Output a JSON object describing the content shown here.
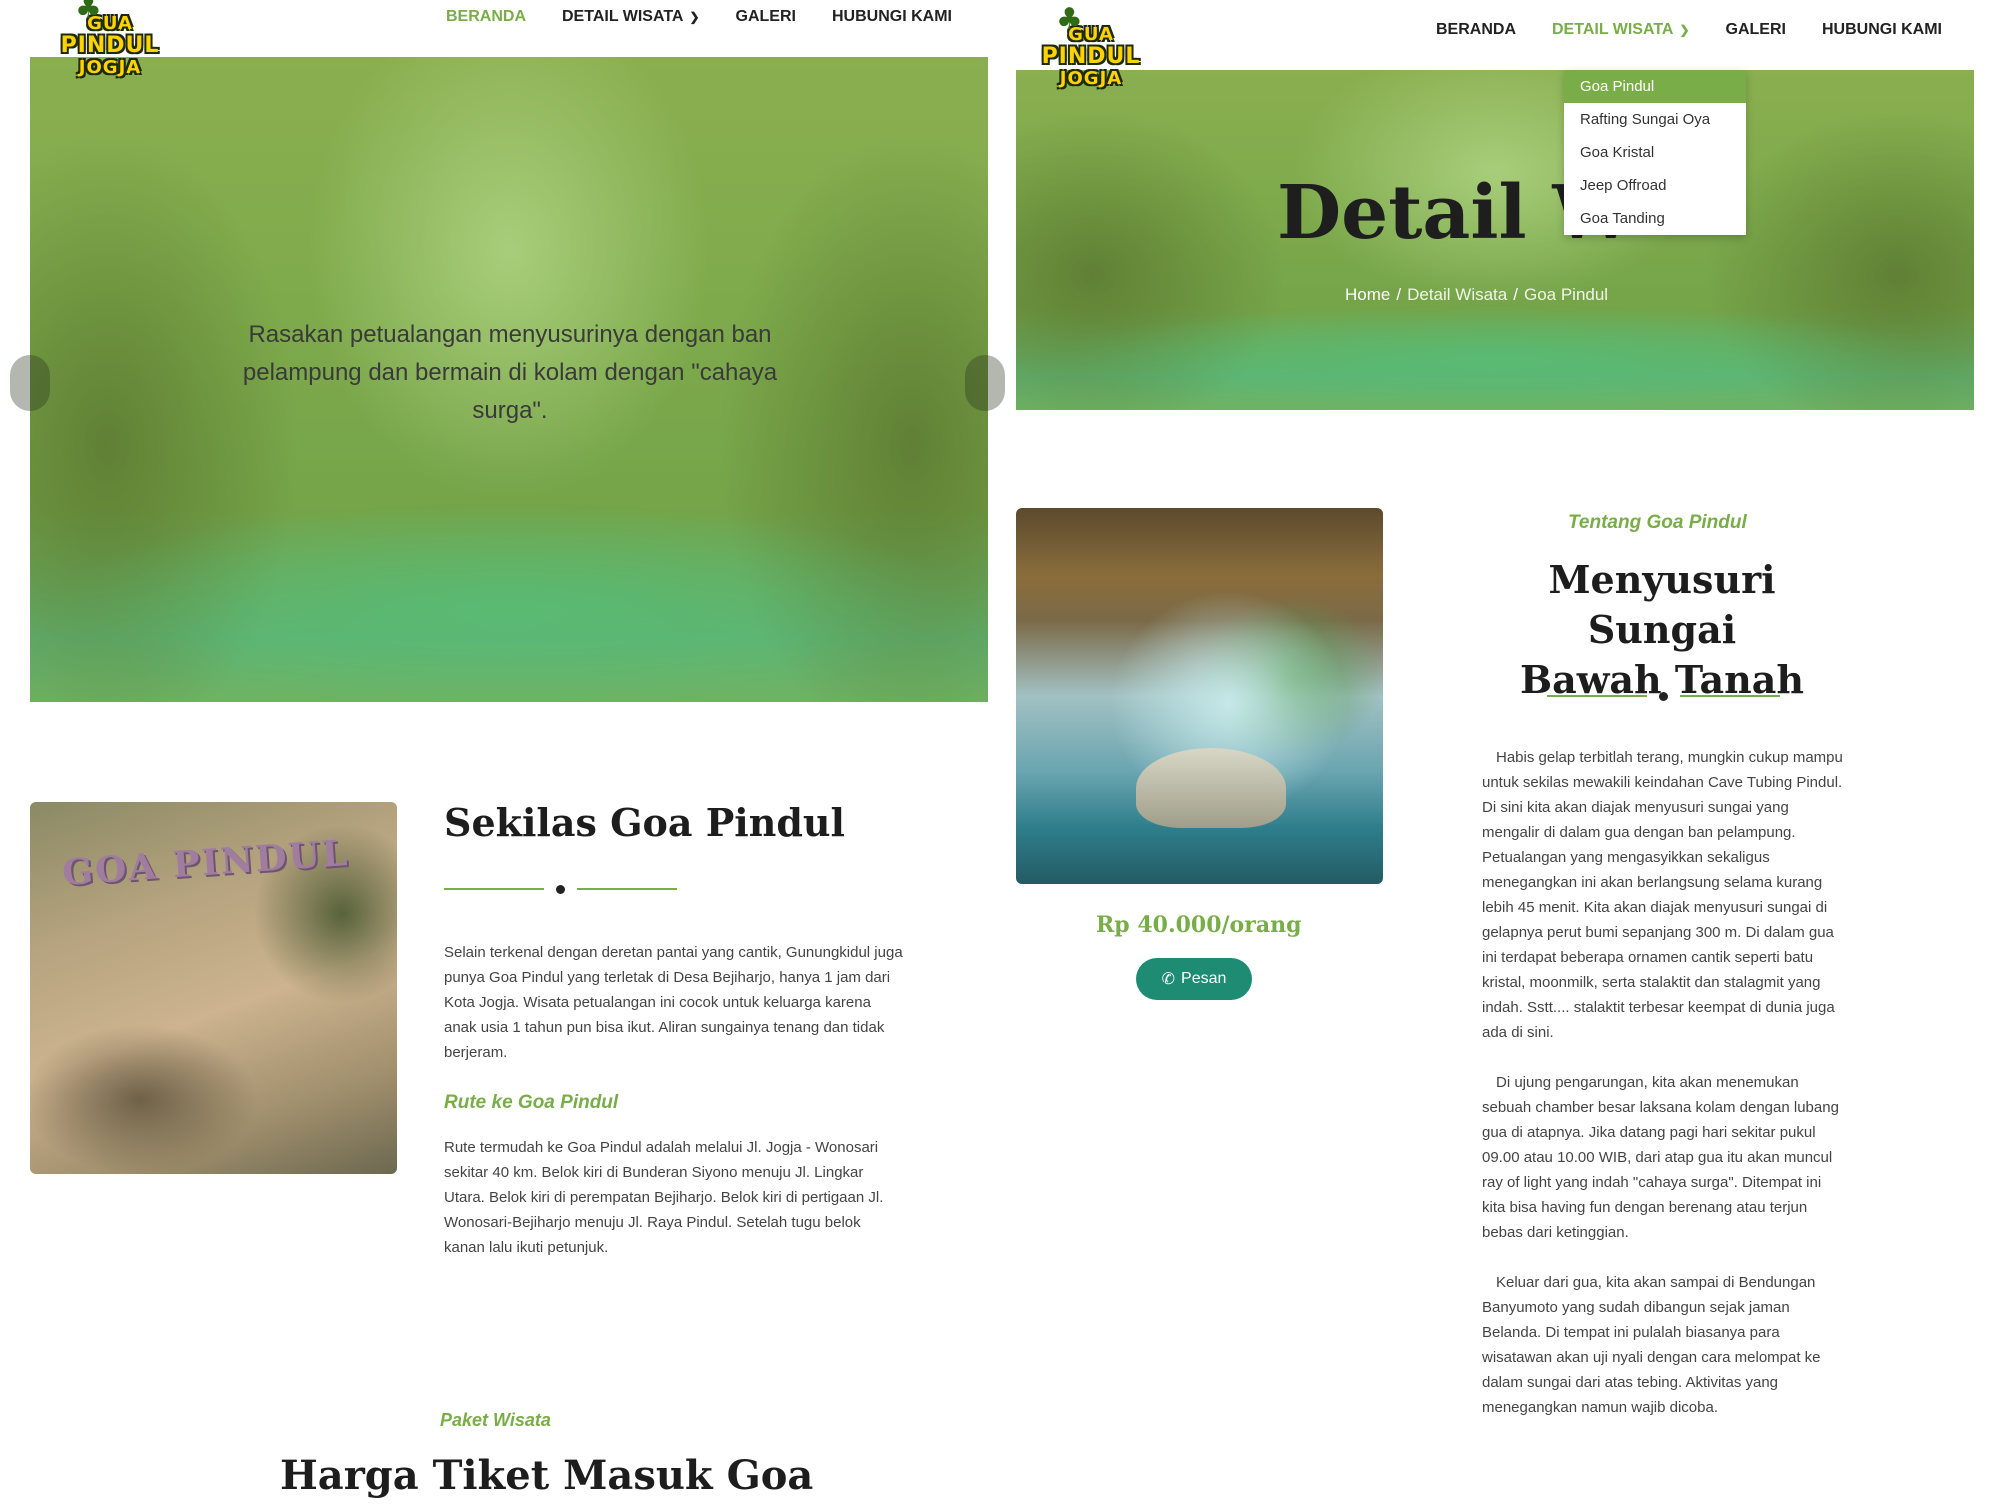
{
  "brand": {
    "logo_line1": "GUA",
    "logo_line2": "PINDUL",
    "logo_line3": "JOGJA"
  },
  "nav": {
    "items": [
      {
        "label": "BERANDA"
      },
      {
        "label": "DETAIL WISATA"
      },
      {
        "label": "GALERI"
      },
      {
        "label": "HUBUNGI KAMI"
      }
    ]
  },
  "left": {
    "hero_caption": "Rasakan petualangan menyusurinya dengan ban pelampung dan bermain di kolam dengan \"cahaya surga\".",
    "sekilas": {
      "title": "Sekilas Goa Pindul",
      "photo_sign": "GOA PINDUL",
      "paragraph": "Selain terkenal dengan deretan pantai yang cantik, Gunungkidul juga punya Goa Pindul yang terletak di Desa Bejiharjo, hanya 1 jam dari Kota Jogja. Wisata petualangan ini cocok untuk keluarga karena anak usia 1 tahun pun bisa ikut. Aliran sungainya tenang dan tidak berjeram.",
      "route_heading": "Rute ke Goa Pindul",
      "route_text": "Rute termudah ke Goa Pindul adalah melalui Jl. Jogja - Wonosari sekitar 40 km. Belok kiri di Bunderan Siyono menuju Jl. Lingkar Utara. Belok kiri di perempatan Bejiharjo. Belok kiri di pertigaan Jl. Wonosari-Bejiharjo menuju Jl. Raya Pindul. Setelah tugu belok kanan lalu ikuti petunjuk."
    },
    "paket": {
      "subtitle": "Paket Wisata",
      "title": "Harga Tiket Masuk Goa"
    }
  },
  "right": {
    "dropdown": [
      "Goa Pindul",
      "Rafting Sungai Oya",
      "Goa Kristal",
      "Jeep Offroad",
      "Goa Tanding"
    ],
    "hero_title": "Detail W",
    "breadcrumb": [
      "Home",
      "Detail Wisata",
      "Goa Pindul"
    ],
    "price": "Rp 40.000/orang",
    "order_button": "Pesan",
    "about": {
      "subtitle": "Tentang Goa Pindul",
      "title_line1": "Menyusuri Sungai",
      "title_line2": "Bawah Tanah",
      "paragraphs": [
        "Habis gelap terbitlah terang, mungkin cukup mampu untuk sekilas mewakili keindahan Cave Tubing Pindul. Di sini kita akan diajak menyusuri sungai yang mengalir di dalam gua dengan ban pelampung. Petualangan yang mengasyikkan sekaligus menegangkan ini akan berlangsung selama kurang lebih 45 menit. Kita akan diajak menyusuri sungai di gelapnya perut bumi sepanjang 300 m. Di dalam gua ini terdapat beberapa ornamen cantik seperti batu kristal, moonmilk, serta stalaktit dan stalagmit yang indah. Sstt.... stalaktit terbesar keempat di dunia juga ada di sini.",
        "Di ujung pengarungan, kita akan menemukan sebuah chamber besar laksana kolam dengan lubang gua di atapnya. Jika datang pagi hari sekitar pukul 09.00 atau 10.00 WIB, dari atap gua itu akan muncul ray of light yang indah \"cahaya surga\". Ditempat ini kita bisa having fun dengan berenang atau terjun bebas dari ketinggian.",
        "Keluar dari gua, kita akan sampai di Bendungan Banyumoto yang sudah dibangun sejak jaman Belanda. Di tempat ini pulalah biasanya para wisatawan akan uji nyali dengan cara melompat ke dalam sungai dari atas tebing. Aktivitas yang menegangkan namun wajib dicoba."
      ]
    }
  },
  "colors": {
    "accent": "#79ad48",
    "button": "#1d8c73"
  }
}
